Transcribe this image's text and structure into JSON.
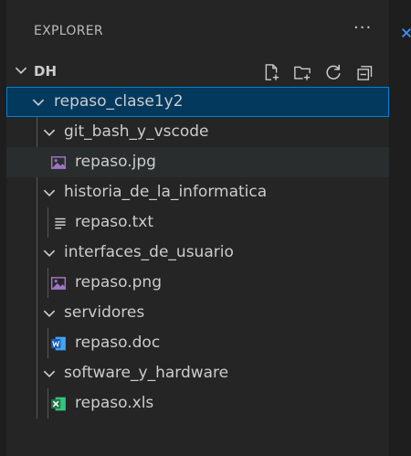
{
  "explorer": {
    "header": "EXPLORER",
    "more_actions": "···",
    "section_title": "DH",
    "actions": [
      "new-file-icon",
      "new-folder-icon",
      "refresh-icon",
      "collapse-all-icon"
    ]
  },
  "tree": {
    "root": "repaso_clase1y2",
    "folders": [
      {
        "name": "git_bash_y_vscode",
        "file": "repaso.jpg",
        "file_icon": "image-file-icon"
      },
      {
        "name": "historia_de_la_informatica",
        "file": "repaso.txt",
        "file_icon": "text-file-icon"
      },
      {
        "name": "interfaces_de_usuario",
        "file": "repaso.png",
        "file_icon": "image-file-icon"
      },
      {
        "name": "servidores",
        "file": "repaso.doc",
        "file_icon": "word-file-icon"
      },
      {
        "name": "software_y_hardware",
        "file": "repaso.xls",
        "file_icon": "excel-file-icon"
      }
    ]
  },
  "colors": {
    "background": "#252526",
    "selection": "#04395e",
    "focus_border": "#007fd4",
    "image_icon": "#a074c4",
    "word_icon": "#185abd",
    "excel_icon": "#1e7a45"
  }
}
